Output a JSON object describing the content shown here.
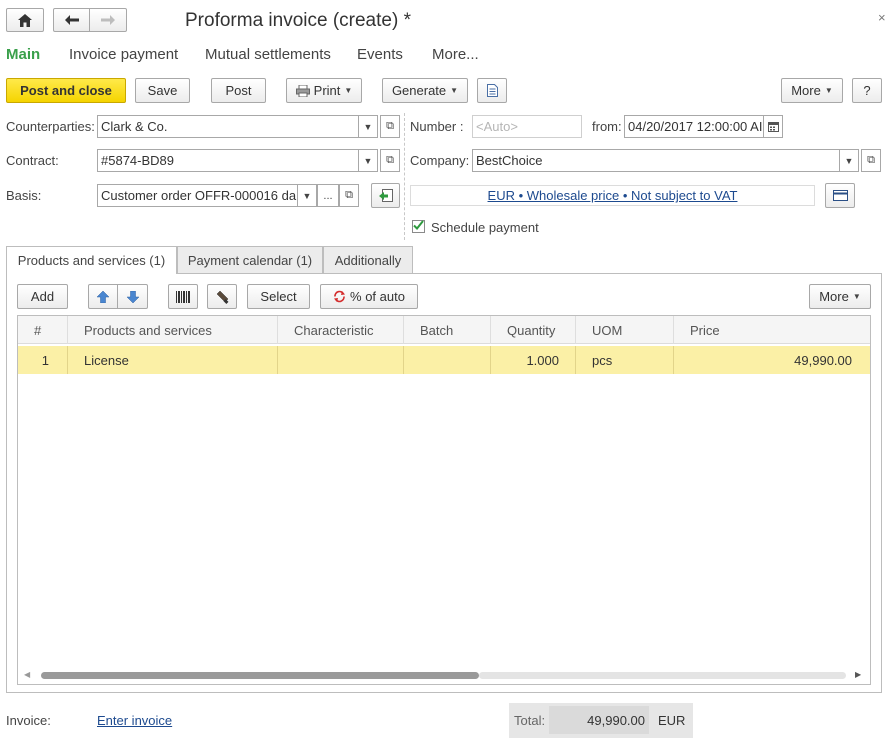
{
  "window": {
    "title": "Proforma invoice (create) *"
  },
  "nav": {
    "tabs": [
      "Main",
      "Invoice payment",
      "Mutual settlements",
      "Events",
      "More..."
    ]
  },
  "toolbar": {
    "post_close": "Post and close",
    "save": "Save",
    "post": "Post",
    "print": "Print",
    "generate": "Generate",
    "more": "More",
    "help": "?"
  },
  "form": {
    "counterparties_label": "Counterparties:",
    "counterparties_value": "Clark & Co.",
    "contract_label": "Contract:",
    "contract_value": "#5874-BD89",
    "basis_label": "Basis:",
    "basis_value": "Customer order OFFR-000016 da",
    "basis_dots": "...",
    "number_label": "Number :",
    "number_placeholder": "<Auto>",
    "from_label": "from:",
    "from_value": "04/20/2017 12:00:00 AI",
    "company_label": "Company:",
    "company_value": "BestChoice",
    "price_link": "EUR • Wholesale price • Not subject to VAT",
    "schedule_label": "Schedule payment",
    "schedule_checked": true
  },
  "tabs": [
    "Products and services (1)",
    "Payment calendar (1)",
    "Additionally"
  ],
  "table_toolbar": {
    "add": "Add",
    "select": "Select",
    "percent_auto": "% of auto",
    "more": "More"
  },
  "table": {
    "columns": [
      "#",
      "Products and services",
      "Characteristic",
      "Batch",
      "Quantity",
      "UOM",
      "Price"
    ],
    "rows": [
      {
        "num": "1",
        "product": "License",
        "characteristic": "",
        "batch": "",
        "quantity": "1.000",
        "uom": "pcs",
        "price": "49,990.00"
      }
    ]
  },
  "footer": {
    "invoice_label": "Invoice:",
    "invoice_link": "Enter invoice",
    "total_label": "Total:",
    "total_value": "49,990.00",
    "currency": "EUR"
  }
}
